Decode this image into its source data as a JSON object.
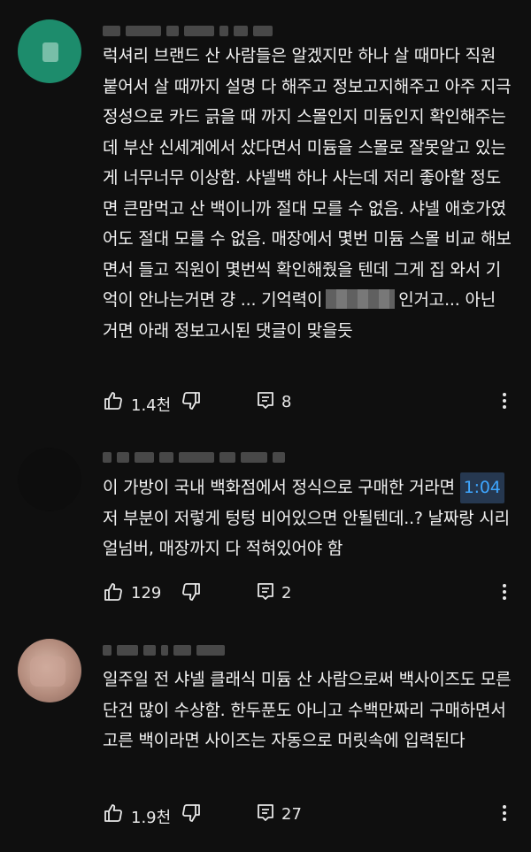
{
  "comments": [
    {
      "text_before": "럭셔리 브랜드 산 사람들은 알겠지만 하나 살 때마다 직원 붙어서 살 때까지 설명 다 해주고 정보고지해주고 아주 지극정성으로 카드 긁을 때 까지 스몰인지 미듐인지 확인해주는데 부산 신세계에서 샀다면서 미듐을 스몰로 잘못알고 있는게 너무너무 이상함. 샤넬백 하나 사는데 저리 좋아할 정도면 큰맘먹고 산 백이니까 절대 모를 수 없음. 샤넬 애호가였어도 절대 모를 수 없음. 매장에서 몇번 미듐 스몰 비교 해보면서 들고 직원이 몇번씩 확인해줬을 텐데 그게 집 와서 기억이 안나는거면 걍 ... 기억력이",
      "text_after": "인거고... 아닌 거면 아래 정보고시된 댓글이 맞을듯",
      "likes": "1.4천",
      "replies": "8"
    },
    {
      "text_before": "이 가방이 국내 백화점에서 정식으로 구매한 거라면",
      "timestamp": "1:04",
      "text_after": "저 부분이 저렇게 텅텅 비어있으면 안될텐데..? 날짜랑 시리얼넘버, 매장까지 다 적혀있어야 함",
      "likes": "129",
      "replies": "2"
    },
    {
      "text": "일주일 전 샤넬 클래식 미듐 산 사람으로써 백사이즈도 모른단건 많이 수상함. 한두푼도 아니고 수백만짜리 구매하면서 고른 백이라면 사이즈는 자동으로 머릿속에 입력된다",
      "likes": "1.9천",
      "replies": "27"
    }
  ],
  "icons": {
    "like": "thumbs-up-icon",
    "dislike": "thumbs-down-icon",
    "reply": "comment-icon",
    "more": "more-vertical-icon"
  },
  "colors": {
    "background": "#0f0f0f",
    "text": "#f1f1f1",
    "timestamp_link": "#3ea6ff"
  }
}
